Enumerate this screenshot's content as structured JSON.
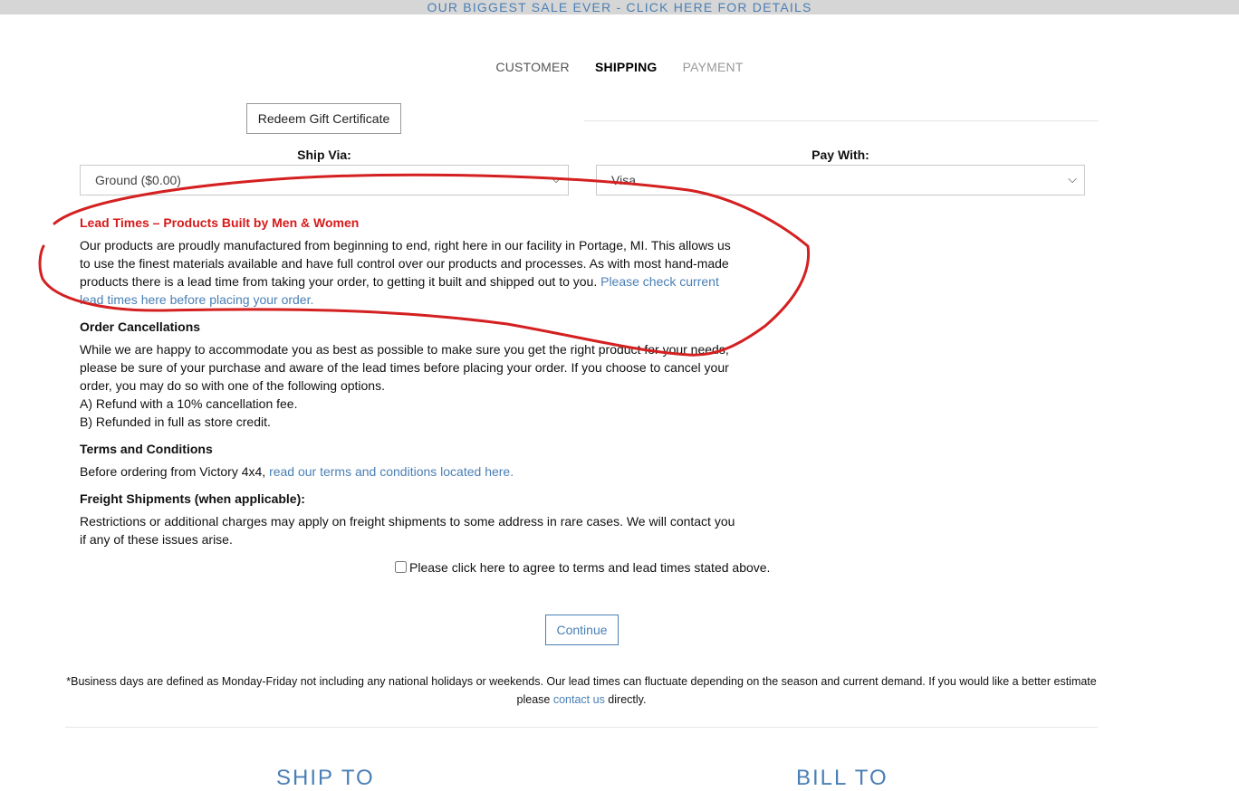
{
  "promo": {
    "text": "OUR BIGGEST SALE EVER - CLICK HERE FOR DETAILS"
  },
  "steps": [
    {
      "label": "CUSTOMER"
    },
    {
      "label": "SHIPPING"
    },
    {
      "label": "PAYMENT"
    }
  ],
  "gift": {
    "button_label": "Redeem Gift Certificate"
  },
  "shipping": {
    "label": "Ship Via:",
    "selected": "Ground ($0.00)"
  },
  "payment": {
    "label": "Pay With:",
    "selected": "Visa"
  },
  "sections": {
    "lead_times": {
      "title": "Lead Times – Products Built by Men & Women",
      "body": "Our products are proudly manufactured from beginning to end, right here in our facility in Portage, MI. This allows us to use the finest materials available and have full control over our products and processes. As with most hand-made products there is a lead time from taking your order, to getting it built and shipped out to you. ",
      "link": "Please check current lead times here before placing your order."
    },
    "cancellations": {
      "title": "Order Cancellations",
      "body": "While we are happy to accommodate you as best as possible to make sure you get the right product for your needs, please be sure of your purchase and aware of the lead times before placing your order. If you choose to cancel your order, you may do so with one of the following options.",
      "option_a": "A) Refund with a 10% cancellation fee.",
      "option_b": "B) Refunded in full as store credit."
    },
    "terms": {
      "title": "Terms and Conditions",
      "body": "Before ordering from Victory 4x4, ",
      "link": "read our terms and conditions located here."
    },
    "freight": {
      "title": "Freight Shipments (when applicable):",
      "body": "Restrictions or additional charges may apply on freight shipments to some address in rare cases. We will contact you if any of these issues arise."
    }
  },
  "agree": {
    "label": "Please click here to agree to terms and lead times stated above."
  },
  "continue": {
    "label": "Continue"
  },
  "footnote": {
    "text": "*Business days are defined as Monday-Friday not including any national holidays or weekends. Our lead times can fluctuate depending on the season and current demand. If you would like a better estimate please ",
    "link": "contact us",
    "suffix": " directly."
  },
  "bottom": {
    "ship_to": "SHIP TO",
    "bill_to": "BILL TO"
  },
  "colors": {
    "accent": "#4a7fb5",
    "lead_title": "#d71a1a",
    "annotation": "#d42020"
  }
}
